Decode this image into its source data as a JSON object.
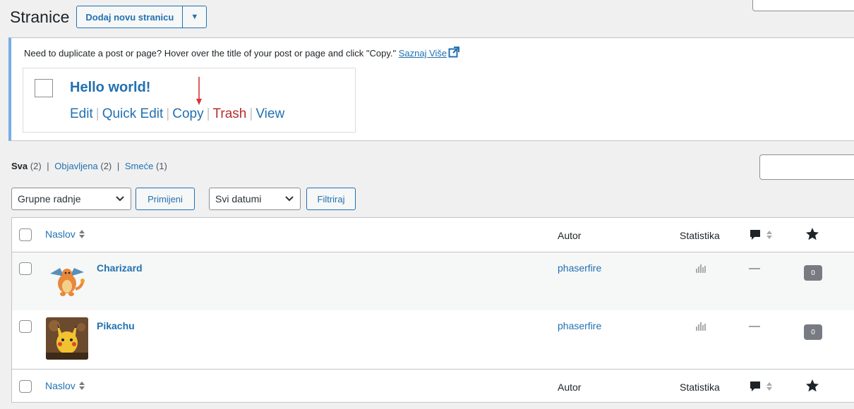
{
  "header": {
    "title": "Stranice",
    "add_button": "Dodaj novu stranicu",
    "dropdown_caret": "▼"
  },
  "notice": {
    "text": "Need to duplicate a post or page? Hover over the title of your post or page and click \"Copy.\"",
    "link": "Saznaj Više",
    "demo_title": "Hello world!",
    "actions": {
      "edit": "Edit",
      "quick_edit": "Quick Edit",
      "copy": "Copy",
      "trash": "Trash",
      "view": "View"
    },
    "arrow_color": "#d63638"
  },
  "filters": {
    "all_label": "Sva",
    "all_count": "(2)",
    "published_label": "Objavljena",
    "published_count": "(2)",
    "trash_label": "Smeće",
    "trash_count": "(1)",
    "bulk_select": "Grupne radnje",
    "apply_button": "Primijeni",
    "date_select": "Svi datumi",
    "filter_button": "Filtriraj"
  },
  "table": {
    "columns": {
      "title": "Naslov",
      "author": "Autor",
      "stats": "Statistika"
    },
    "rows": [
      {
        "title": "Charizard",
        "author": "phaserfire",
        "comments_dash": "—",
        "badge": "0"
      },
      {
        "title": "Pikachu",
        "author": "phaserfire",
        "comments_dash": "—",
        "badge": "0"
      }
    ]
  },
  "colors": {
    "link": "#2271b1",
    "trash": "#b32d2e",
    "notice_border": "#72aee6",
    "badge": "#787c82"
  }
}
